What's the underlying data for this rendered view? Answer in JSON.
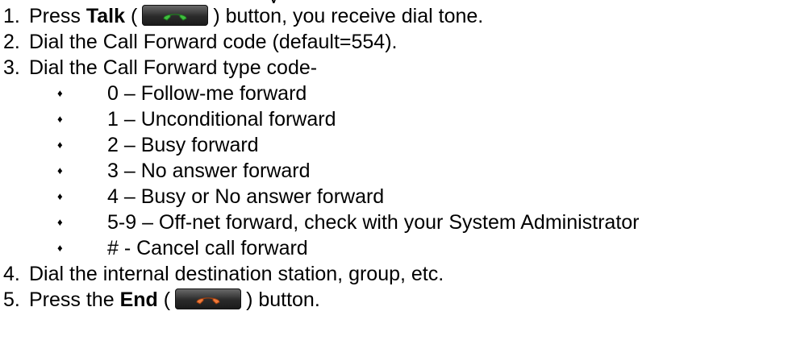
{
  "steps": [
    {
      "number": "1.",
      "before": "Press ",
      "bold": "Talk",
      "open": " (",
      "icon": "talk-button-icon",
      "close": ") button, you receive dial tone."
    },
    {
      "number": "2.",
      "text": "Dial the Call Forward code (default=554)."
    },
    {
      "number": "3.",
      "text": "Dial the Call Forward type code-"
    },
    {
      "number": "4.",
      "text": "Dial the internal destination station, group, etc."
    },
    {
      "number": "5.",
      "before": "Press the ",
      "bold": "End",
      "open": " (",
      "icon": "end-button-icon",
      "close": ") button."
    }
  ],
  "forward_types": [
    "0 – Follow-me forward",
    "1 – Unconditional forward",
    "2 – Busy forward",
    "3 – No answer forward",
    "4 – Busy or No answer forward",
    "5-9 – Off-net forward, check with your System Administrator",
    "# - Cancel call forward"
  ],
  "bullet_glyph": "♦",
  "colors": {
    "talk_handset": "#3fbf3f",
    "end_handset": "#f07a3a",
    "text": "#000000"
  }
}
